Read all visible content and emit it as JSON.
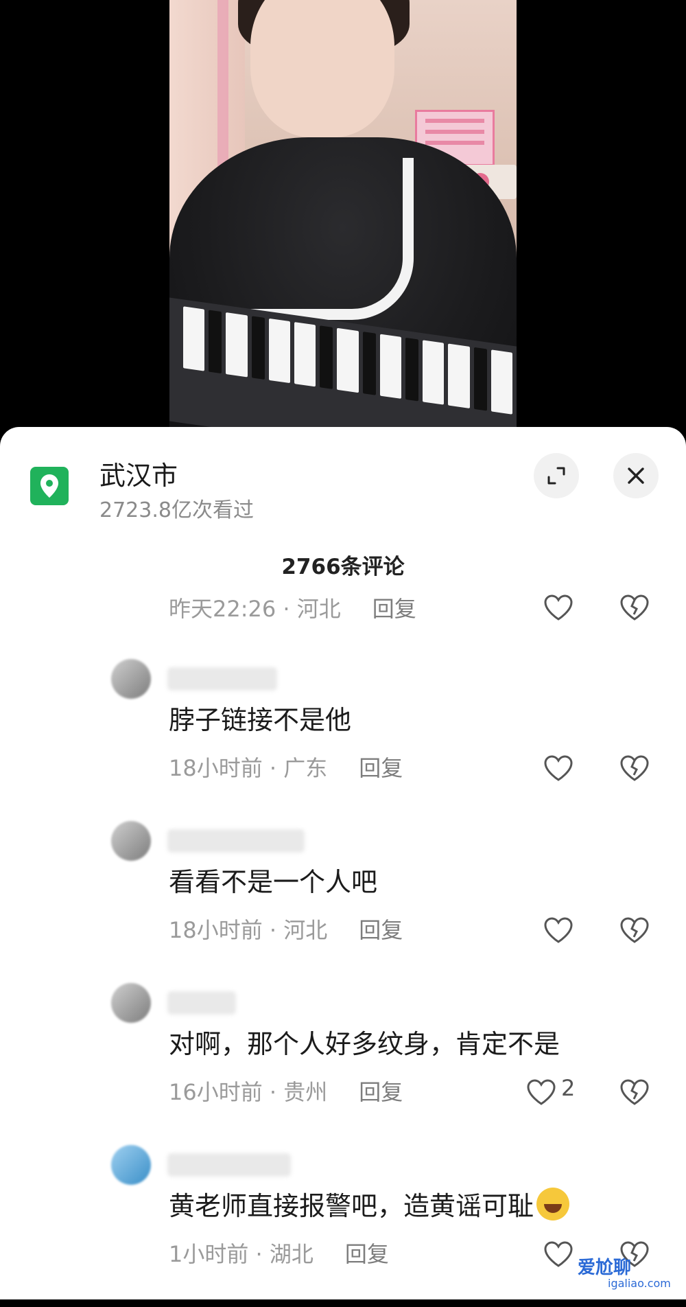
{
  "location": {
    "title": "武汉市",
    "views": "2723.8亿次看过",
    "icon": "location-pin-icon",
    "accent": "#20b25b"
  },
  "comment_count": "2766条评论",
  "first_meta": {
    "time": "昨天22:26",
    "region": "河北",
    "reply": "回复"
  },
  "comments": [
    {
      "text": "脖子链接不是他",
      "time": "18小时前",
      "region": "广东",
      "reply": "回复",
      "likes": ""
    },
    {
      "text": "看看不是一个人吧",
      "time": "18小时前",
      "region": "河北",
      "reply": "回复",
      "likes": ""
    },
    {
      "text": "对啊，那个人好多纹身，肯定不是",
      "time": "16小时前",
      "region": "贵州",
      "reply": "回复",
      "likes": "2"
    },
    {
      "text": "黄老师直接报警吧，造黄谣可耻",
      "time": "1小时前",
      "region": "湖北",
      "reply": "回复",
      "likes": ""
    }
  ],
  "separator": "·",
  "watermark": {
    "main": "爱尬聊",
    "sub": "igaliao.com"
  }
}
